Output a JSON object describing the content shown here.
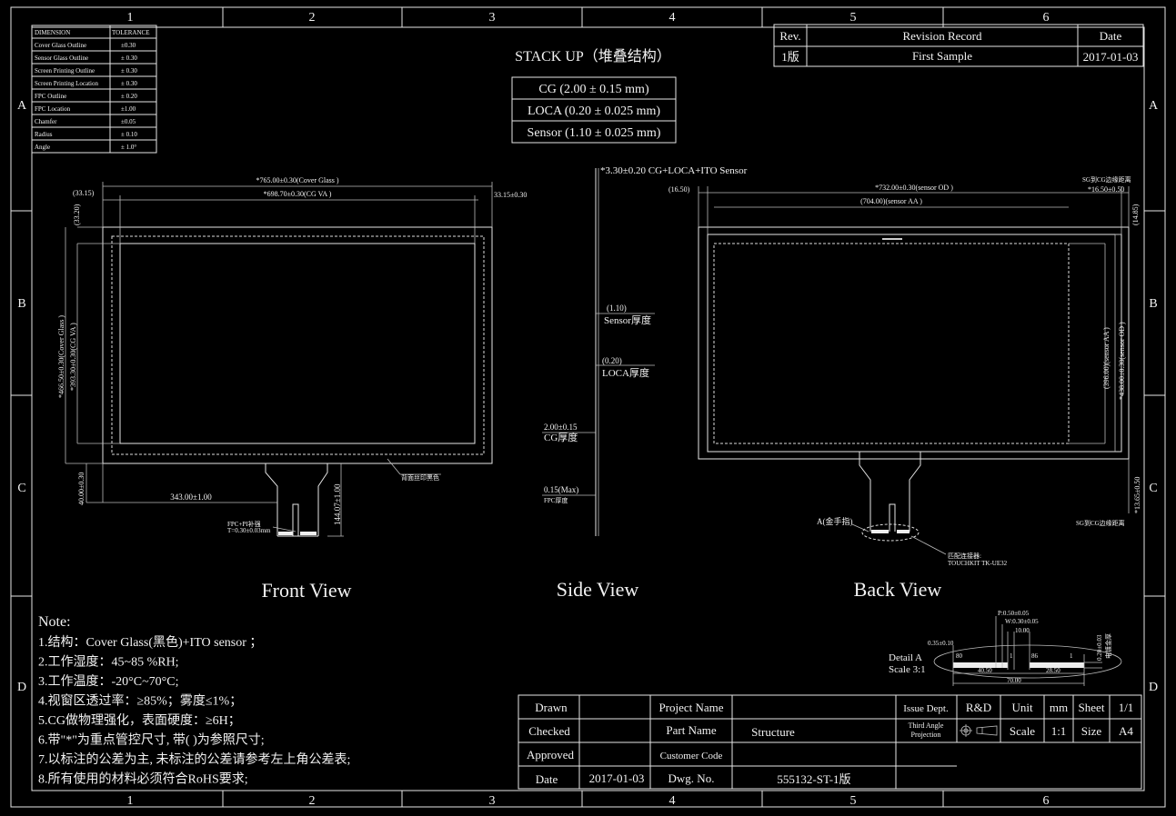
{
  "frame": {
    "columns": [
      "1",
      "2",
      "3",
      "4",
      "5",
      "6"
    ],
    "rows": [
      "A",
      "B",
      "C",
      "D"
    ]
  },
  "tolerance_table": {
    "headers": [
      "DIMENSION",
      "TOLERANCE"
    ],
    "rows": [
      [
        "Cover Glass Outline",
        "±0.30"
      ],
      [
        "Sensor Glass Outline",
        "± 0.30"
      ],
      [
        "Screen Printing Outline",
        "± 0.30"
      ],
      [
        "Screen Printing Location",
        "± 0.30"
      ],
      [
        "FPC Outline",
        "± 0.20"
      ],
      [
        "FPC Location",
        "±1.00"
      ],
      [
        "Chamfer",
        "±0.05"
      ],
      [
        "Radius",
        "± 0.10"
      ],
      [
        "Angle",
        "± 1.0°"
      ]
    ]
  },
  "stackup": {
    "title": "STACK UP（堆叠结构）",
    "layers": [
      "CG (2.00 ± 0.15 mm)",
      "LOCA (0.20 ± 0.025 mm)",
      "Sensor (1.10 ± 0.025 mm)"
    ]
  },
  "revision": {
    "headers": [
      "Rev.",
      "Revision  Record",
      "Date"
    ],
    "rows": [
      [
        "1版",
        "First Sample",
        "2017-01-03"
      ]
    ]
  },
  "front_view": {
    "title": "Front View",
    "dims": {
      "cg_width": "*765.00±0.30(Cover Glass )",
      "va_width": "*698.70±0.30(CG VA )",
      "left_margin": "(33.15)",
      "right_margin": "33.15±0.30",
      "top_margin": "(33.20)",
      "cg_height": "*466.50±0.30(Cover Glass )",
      "va_height": "*393.30±0.30(CG VA )",
      "bottom_offset": "40.00±0.30",
      "fpc_x": "343.00±1.00",
      "fpc_length": "144.07±1.00"
    },
    "notes": {
      "print": "背面丝印黑色",
      "fpc": "FPC+PI补强",
      "fpc_t": "T=0.30±0.03mm"
    }
  },
  "side_view": {
    "title": "Side View",
    "header": "*3.30±0.20  CG+LOCA+ITO Sensor",
    "labels": [
      [
        "(1.10)",
        "Sensor厚度"
      ],
      [
        "(0.20)",
        "LOCA厚度"
      ],
      [
        "2.00±0.15",
        "CG厚度"
      ],
      [
        "0.15(Max)",
        "FPC厚度"
      ]
    ]
  },
  "back_view": {
    "title": "Back View",
    "dims": {
      "od_width": "*732.00±0.30(sensor OD )",
      "aa_width": "(704.00)(sensor AA )",
      "left": "(16.50)",
      "right": "*16.50±0.50",
      "right_note": "SG到CG边缘距离",
      "top": "(14.85)",
      "aa_height": "(396.00)(sensor AA )",
      "od_height": "*438.00±0.30(sensor OD )",
      "bottom": "*13.65±0.50",
      "bottom_note": "SG到CG边缘距离"
    },
    "notes": {
      "finger": "A(金手指)",
      "connector_1": "匹配连接器:",
      "connector_2": "TOUCHKIT TK-UE32"
    }
  },
  "detail": {
    "title": "Detail A",
    "scale": "Scale 3:1",
    "p": "P:0.50±0.05",
    "w": "W:0.30±0.05",
    "gap": "10.00",
    "edge": "0.35±0.10",
    "n1": "80",
    "n2": "1",
    "n3": "86",
    "n4": "1",
    "a": "40.50",
    "b": "28.50",
    "total": "70.00",
    "thick": "0.20±0.03",
    "thick_note": "电镀金厚"
  },
  "notes": {
    "title": "Note:",
    "items": [
      "1.结构：Cover Glass(黑色)+ITO sensor ；",
      "2.工作湿度：45~85 %RH;",
      "3.工作温度：-20°C~70°C;",
      "4.视窗区透过率：≥85%；雾度≤1%；",
      "5.CG做物理强化，表面硬度：≥6H；",
      "6.带\"*\"为重点管控尺寸, 带( )为参照尺寸;",
      "7.以标注的公差为主, 未标注的公差请参考左上角公差表;",
      "8.所有使用的材料必须符合RoHS要求;"
    ]
  },
  "title_block": {
    "drawn": "Drawn",
    "checked": "Checked",
    "approved": "Approved",
    "date_label": "Date",
    "date": "2017-01-03",
    "project_name": "Project  Name",
    "part_name": "Part  Name",
    "part_value": "Structure",
    "customer_code": "Customer Code",
    "dwg_no": "Dwg. No.",
    "dwg_value": "555132-ST-1版",
    "issue_dept": "Issue Dept.",
    "dept": "R&D",
    "unit_label": "Unit",
    "unit": "mm",
    "sheet_label": "Sheet",
    "sheet": "1/1",
    "projection_1": "Third Angle",
    "projection_2": "Projection",
    "scale_label": "Scale",
    "scale": "1:1",
    "size_label": "Size",
    "size": "A4"
  }
}
